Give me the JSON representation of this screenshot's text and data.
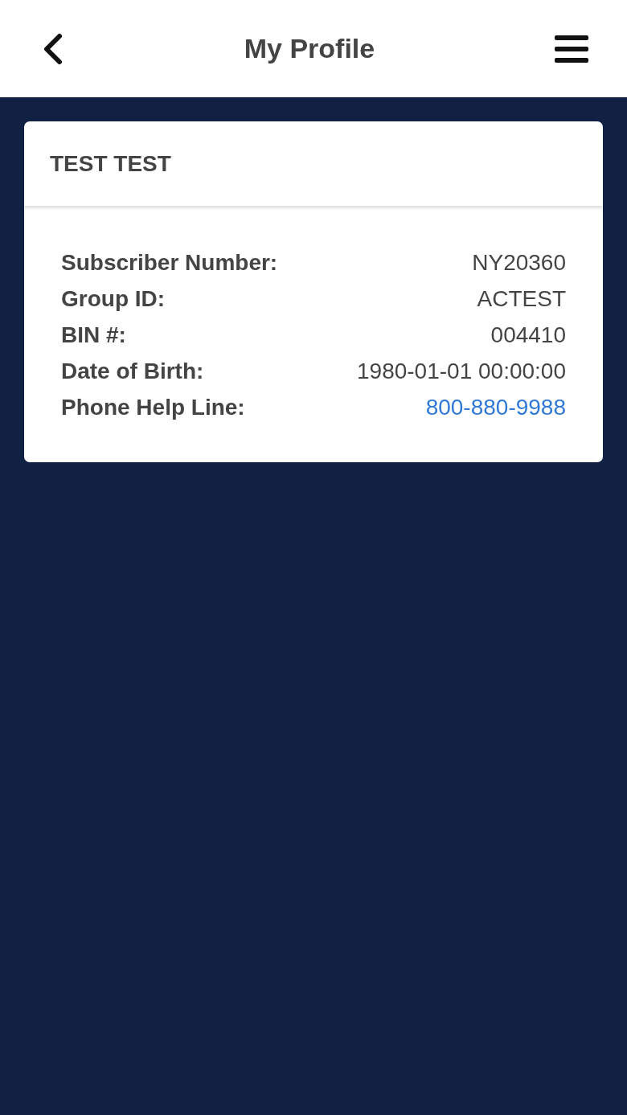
{
  "header": {
    "title": "My Profile"
  },
  "profile": {
    "name": "TEST TEST",
    "rows": [
      {
        "label": "Subscriber Number:",
        "value": "NY20360",
        "kind": "text"
      },
      {
        "label": "Group ID:",
        "value": "ACTEST",
        "kind": "text"
      },
      {
        "label": "BIN #:",
        "value": "004410",
        "kind": "text"
      },
      {
        "label": "Date of Birth:",
        "value": "1980-01-01 00:00:00",
        "kind": "text"
      },
      {
        "label": "Phone Help Line:",
        "value": "800-880-9988",
        "kind": "link"
      }
    ]
  }
}
